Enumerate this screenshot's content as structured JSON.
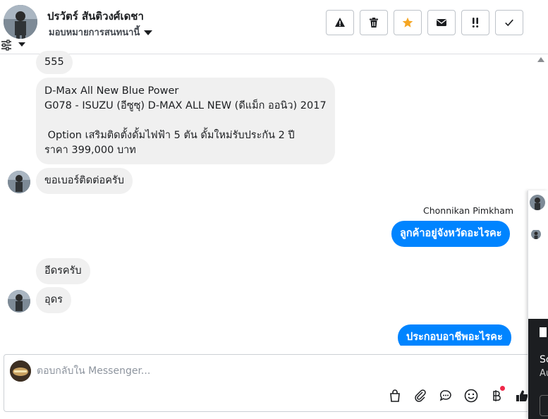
{
  "header": {
    "name": "ปรวัตร์ สันติวงศ์เดชา",
    "assign_label": "มอบหมายการสนทนานี้",
    "buttons": [
      {
        "name": "mark-spam-button",
        "icon": "warning-icon"
      },
      {
        "name": "delete-button",
        "icon": "trash-icon"
      },
      {
        "name": "star-button",
        "icon": "star-icon"
      },
      {
        "name": "mark-unread-button",
        "icon": "envelope-icon"
      },
      {
        "name": "follow-up-button",
        "icon": "exclamation-icon"
      },
      {
        "name": "mark-done-button",
        "icon": "check-icon"
      }
    ],
    "star_color": "#f5a623"
  },
  "messages": {
    "m1": "555",
    "m2_line1": "D-Max All New Blue Power",
    "m2_line2": "G078 - ISUZU (อีซูซุ) D-MAX ALL NEW (ดีแม็ก ออนิว) 2017",
    "m2_line3": " Option เสริมติดตั้งดั้มไฟฟ้า 5 ตัน ดั้มใหม่รับประกัน 2 ปี",
    "m2_line4": "ราคา 399,000 บาท",
    "m3": "ขอเบอร์ติดต่อครับ",
    "agent_name": "Chonnikan Pimkham",
    "m4": "ลูกค้าอยู่จังหวัดอะไรคะ",
    "m5": "อีดรครับ",
    "m6": "อุดร",
    "m7": "ประกอบอาชีพอะไรคะ"
  },
  "composer": {
    "placeholder": "ตอบกลับใน Messenger..."
  },
  "colors": {
    "outgoing_bubble": "#0084ff",
    "incoming_bubble": "#f0f0f0"
  },
  "side_panel": {
    "text1": "Sc",
    "text2": "Au"
  }
}
